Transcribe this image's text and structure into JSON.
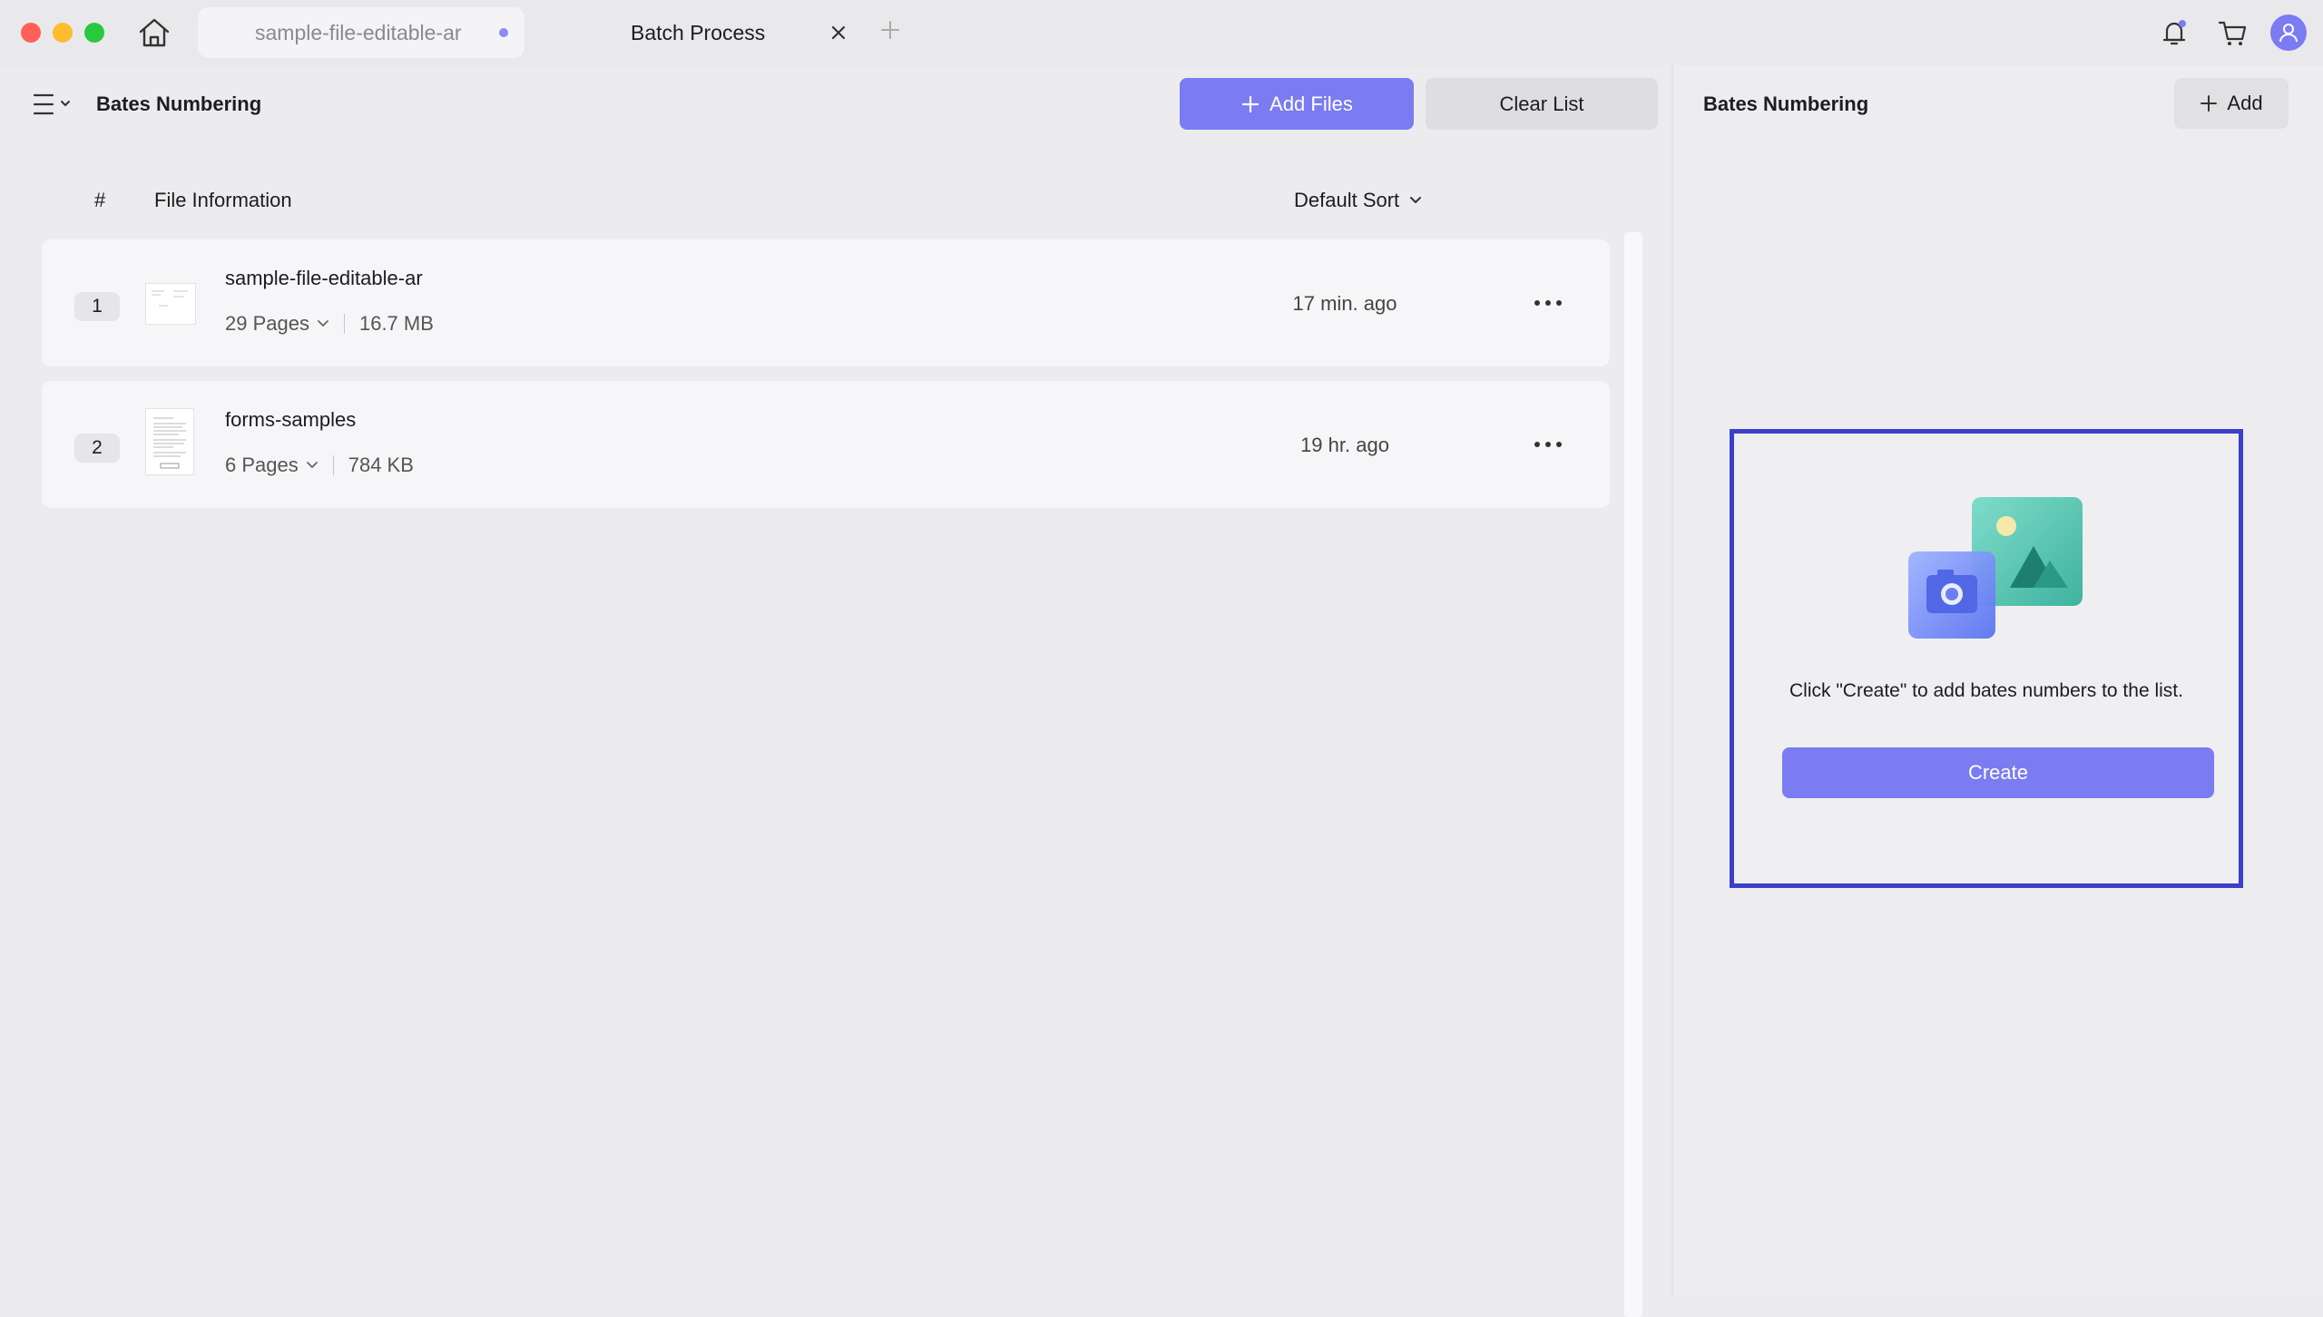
{
  "titlebar": {
    "tabs": [
      {
        "label": "sample-file-editable-ar",
        "active": false
      },
      {
        "label": "Batch Process",
        "active": true
      }
    ]
  },
  "left": {
    "title": "Bates Numbering",
    "add_files_label": "Add Files",
    "clear_list_label": "Clear List",
    "columns": {
      "index": "#",
      "info": "File Information"
    },
    "sort_label": "Default Sort",
    "files": [
      {
        "index": "1",
        "name": "sample-file-editable-ar",
        "pages": "29 Pages",
        "size": "16.7 MB",
        "time": "17 min. ago"
      },
      {
        "index": "2",
        "name": "forms-samples",
        "pages": "6 Pages",
        "size": "784 KB",
        "time": "19 hr. ago"
      }
    ]
  },
  "right": {
    "title": "Bates Numbering",
    "add_label": "Add",
    "empty_message": "Click \"Create\" to add bates numbers to the list.",
    "create_label": "Create"
  },
  "colors": {
    "accent": "#7B7BF2",
    "highlight_border": "#3B3FCB"
  }
}
